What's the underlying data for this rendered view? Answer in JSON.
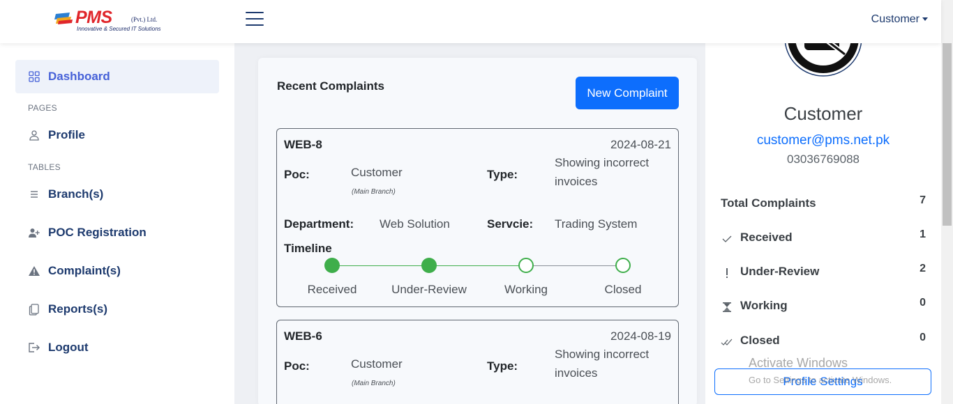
{
  "header": {
    "logo_text": "PMS",
    "logo_sub": "(Pvt.) Ltd.",
    "logo_tagline": "Innovative & Secured IT Solutions",
    "user_menu_label": "Customer"
  },
  "sidebar": {
    "dashboard": "Dashboard",
    "section_pages": "PAGES",
    "profile": "Profile",
    "section_tables": "TABLES",
    "branches": "Branch(s)",
    "poc_registration": "POC Registration",
    "complaints": "Complaint(s)",
    "reports": "Reports(s)",
    "logout": "Logout"
  },
  "main": {
    "title": "Recent Complaints",
    "new_button": "New Complaint",
    "labels": {
      "poc": "Poc:",
      "type": "Type:",
      "department": "Department:",
      "service": "Servcie:",
      "timeline": "Timeline"
    },
    "complaints": [
      {
        "id": "WEB-8",
        "date": "2024-08-21",
        "poc": "Customer",
        "poc_branch": "(Main Branch)",
        "type": "Showing incorrect invoices",
        "department": "Web Solution",
        "service": "Trading System",
        "timeline": [
          {
            "label": "Received",
            "done": true
          },
          {
            "label": "Under-Review",
            "done": true
          },
          {
            "label": "Working",
            "done": false
          },
          {
            "label": "Closed",
            "done": false
          }
        ]
      },
      {
        "id": "WEB-6",
        "date": "2024-08-19",
        "poc": "Customer",
        "poc_branch": "(Main Branch)",
        "type": "Showing incorrect invoices"
      }
    ]
  },
  "profile_panel": {
    "name": "Customer",
    "email": "customer@pms.net.pk",
    "phone": "03036769088",
    "stats": {
      "total_label": "Total Complaints",
      "total_value": "7",
      "received_label": "Received",
      "received_value": "1",
      "review_label": "Under-Review",
      "review_value": "2",
      "working_label": "Working",
      "working_value": "0",
      "closed_label": "Closed",
      "closed_value": "0"
    },
    "settings_button": "Profile Settings"
  },
  "watermark": {
    "title": "Activate Windows",
    "subtitle": "Go to Settings to activate Windows."
  },
  "colors": {
    "primary": "#0d6efd",
    "navy": "#1d3a6e",
    "active_nav": "#4661d8",
    "timeline_green": "#3fae4b",
    "logo_red": "#e0262b"
  }
}
